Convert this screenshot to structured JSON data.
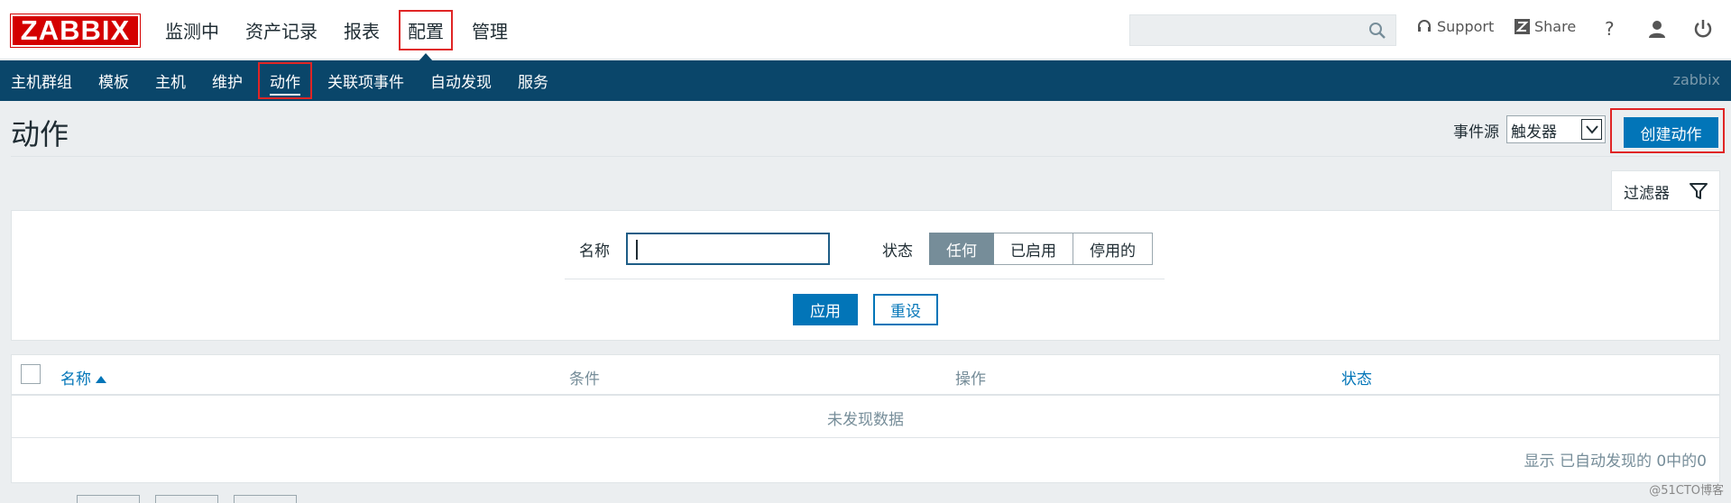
{
  "header": {
    "logo_text": "ZABBIX",
    "menu": [
      {
        "label": "监测中"
      },
      {
        "label": "资产记录"
      },
      {
        "label": "报表"
      },
      {
        "label": "配置"
      },
      {
        "label": "管理"
      }
    ],
    "selected_menu": "配置",
    "support_label": "Support",
    "share_label": "Share",
    "help_label": "?"
  },
  "subnav": {
    "items": [
      {
        "label": "主机群组"
      },
      {
        "label": "模板"
      },
      {
        "label": "主机"
      },
      {
        "label": "维护"
      },
      {
        "label": "动作"
      },
      {
        "label": "关联项事件"
      },
      {
        "label": "自动发现"
      },
      {
        "label": "服务"
      }
    ],
    "selected": "动作",
    "server_name": "zabbix"
  },
  "page": {
    "title": "动作",
    "event_source_label": "事件源",
    "event_source_value": "触发器",
    "create_button": "创建动作"
  },
  "filter": {
    "tab_label": "过滤器",
    "name_label": "名称",
    "name_value": "",
    "status_label": "状态",
    "status_options": [
      "任何",
      "已启用",
      "停用的"
    ],
    "status_selected": "任何",
    "apply_label": "应用",
    "reset_label": "重设"
  },
  "table": {
    "columns": [
      "名称",
      "条件",
      "操作",
      "状态"
    ],
    "empty_text": "未发现数据",
    "pager_text": "显示 已自动发现的 0中的0"
  },
  "watermark": "@51CTO博客",
  "colors": {
    "brand_red": "#d40000",
    "nav_blue": "#0a466a",
    "primary_button": "#0275b8",
    "highlight_border": "#e02525",
    "segment_active": "#768d99"
  }
}
